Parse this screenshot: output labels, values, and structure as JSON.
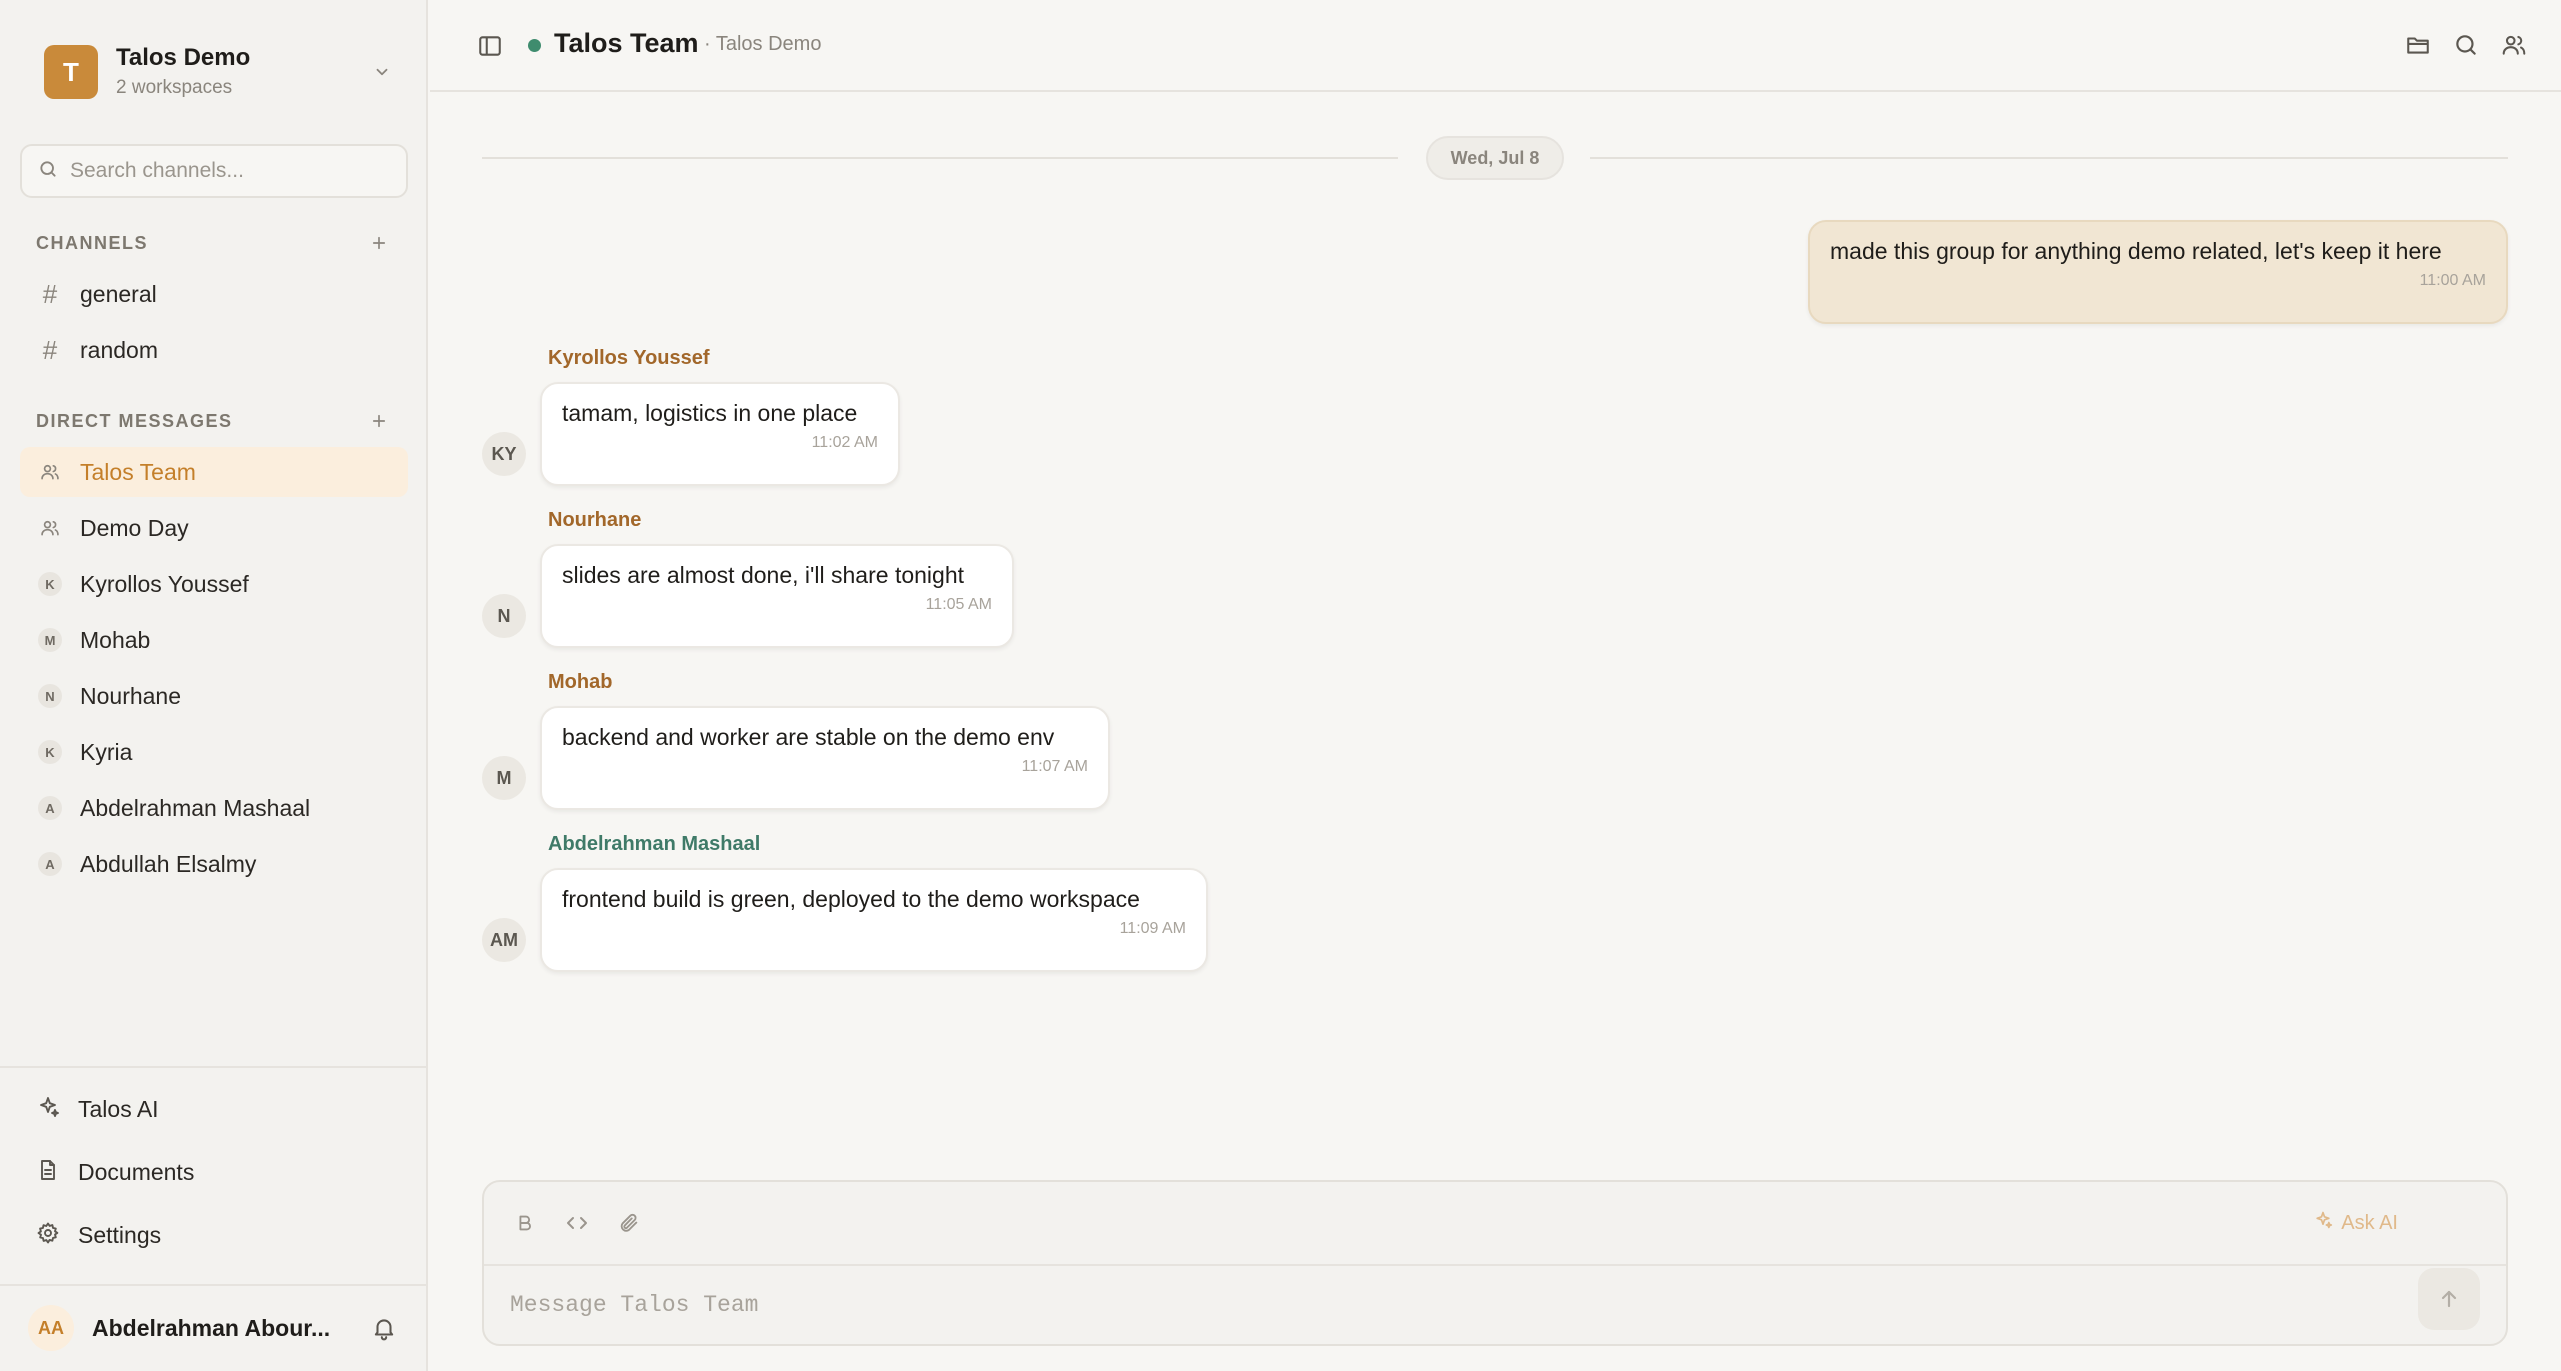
{
  "workspace": {
    "name": "Talos Demo",
    "subtitle": "2 workspaces",
    "logo_letter": "T",
    "accent": "#c98a3a"
  },
  "search": {
    "placeholder": "Search channels..."
  },
  "channels": {
    "title": "CHANNELS",
    "items": [
      {
        "label": "general"
      },
      {
        "label": "random"
      }
    ]
  },
  "direct_messages": {
    "title": "DIRECT MESSAGES",
    "items": [
      {
        "label": "Talos Team",
        "kind": "group",
        "active": true
      },
      {
        "label": "Demo Day",
        "kind": "group"
      },
      {
        "label": "Kyrollos Youssef",
        "initial": "K"
      },
      {
        "label": "Mohab",
        "initial": "M"
      },
      {
        "label": "Nourhane",
        "initial": "N"
      },
      {
        "label": "Kyria",
        "initial": "K"
      },
      {
        "label": "Abdelrahman Mashaal",
        "initial": "A"
      },
      {
        "label": "Abdullah Elsalmy",
        "initial": "A"
      }
    ]
  },
  "bottom_nav": [
    {
      "label": "Talos AI",
      "icon": "sparkle-icon"
    },
    {
      "label": "Documents",
      "icon": "document-icon"
    },
    {
      "label": "Settings",
      "icon": "gear-icon"
    }
  ],
  "current_user": {
    "initials": "AA",
    "name": "Abdelrahman Abour..."
  },
  "header": {
    "title": "Talos Team",
    "subtitle": "· Talos Demo",
    "status_color": "#3f8c6e"
  },
  "date_divider": "Wed, Jul 8",
  "messages": [
    {
      "own": true,
      "text": "made this group for anything demo related, let's keep it here",
      "time": "11:00 AM"
    },
    {
      "sender": "Kyrollos Youssef",
      "initials": "KY",
      "text": "tamam, logistics in one place",
      "time": "11:02 AM"
    },
    {
      "sender": "Nourhane",
      "initials": "N",
      "text": "slides are almost done, i'll share tonight",
      "time": "11:05 AM"
    },
    {
      "sender": "Mohab",
      "initials": "M",
      "text": "backend and worker are stable on the demo env",
      "time": "11:07 AM"
    },
    {
      "sender": "Abdelrahman Mashaal",
      "initials": "AM",
      "text": "frontend build is green, deployed to the demo workspace",
      "time": "11:09 AM"
    }
  ],
  "composer": {
    "placeholder": "Message Talos Team",
    "ask_ai_label": "Ask AI"
  }
}
